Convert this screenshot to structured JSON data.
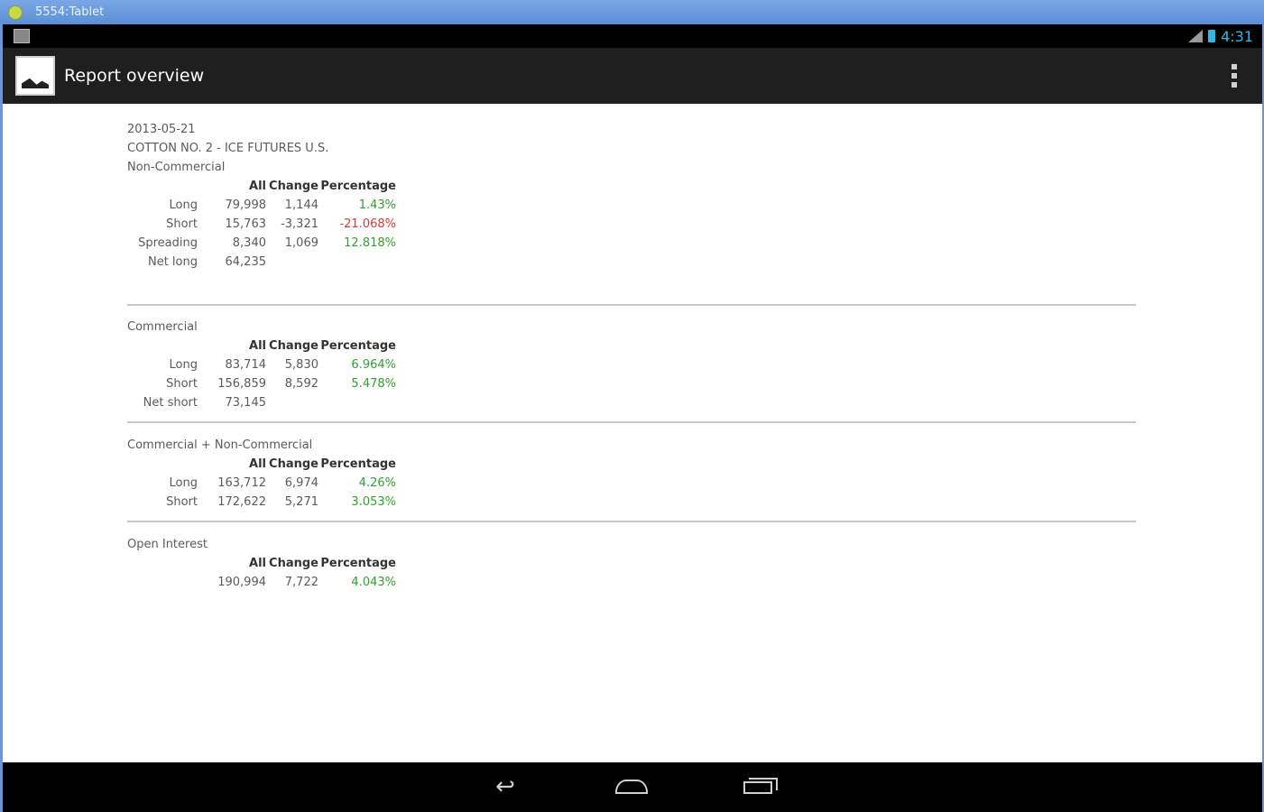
{
  "emulator": {
    "title": "5554:Tablet"
  },
  "statusbar": {
    "time": "4:31"
  },
  "actionbar": {
    "title": "Report overview"
  },
  "report": {
    "date": "2013-05-21",
    "market": "COTTON NO. 2 - ICE FUTURES U.S.",
    "headers": {
      "all": "All",
      "change": "Change",
      "percentage": "Percentage"
    },
    "non_commercial": {
      "title": "Non-Commercial",
      "rows": [
        {
          "label": "Long",
          "all": "79,998",
          "change": "1,144",
          "pct": "1.43%"
        },
        {
          "label": "Short",
          "all": "15,763",
          "change": "-3,321",
          "pct": "-21.068%"
        },
        {
          "label": "Spreading",
          "all": "8,340",
          "change": "1,069",
          "pct": "12.818%"
        },
        {
          "label": "Net long",
          "all": "64,235",
          "change": "",
          "pct": ""
        }
      ]
    },
    "commercial": {
      "title": "Commercial",
      "rows": [
        {
          "label": "Long",
          "all": "83,714",
          "change": "5,830",
          "pct": "6.964%"
        },
        {
          "label": "Short",
          "all": "156,859",
          "change": "8,592",
          "pct": "5.478%"
        },
        {
          "label": "Net short",
          "all": "73,145",
          "change": "",
          "pct": ""
        }
      ]
    },
    "combined": {
      "title": "Commercial + Non-Commercial",
      "rows": [
        {
          "label": "Long",
          "all": "163,712",
          "change": "6,974",
          "pct": "4.26%"
        },
        {
          "label": "Short",
          "all": "172,622",
          "change": "5,271",
          "pct": "3.053%"
        }
      ]
    },
    "open_interest": {
      "title": "Open Interest",
      "rows": [
        {
          "label": "",
          "all": "190,994",
          "change": "7,722",
          "pct": "4.043%"
        }
      ]
    }
  },
  "colors": {
    "positive": "#2ea12e",
    "negative": "#d23a3a",
    "accent": "#33b5e5"
  }
}
